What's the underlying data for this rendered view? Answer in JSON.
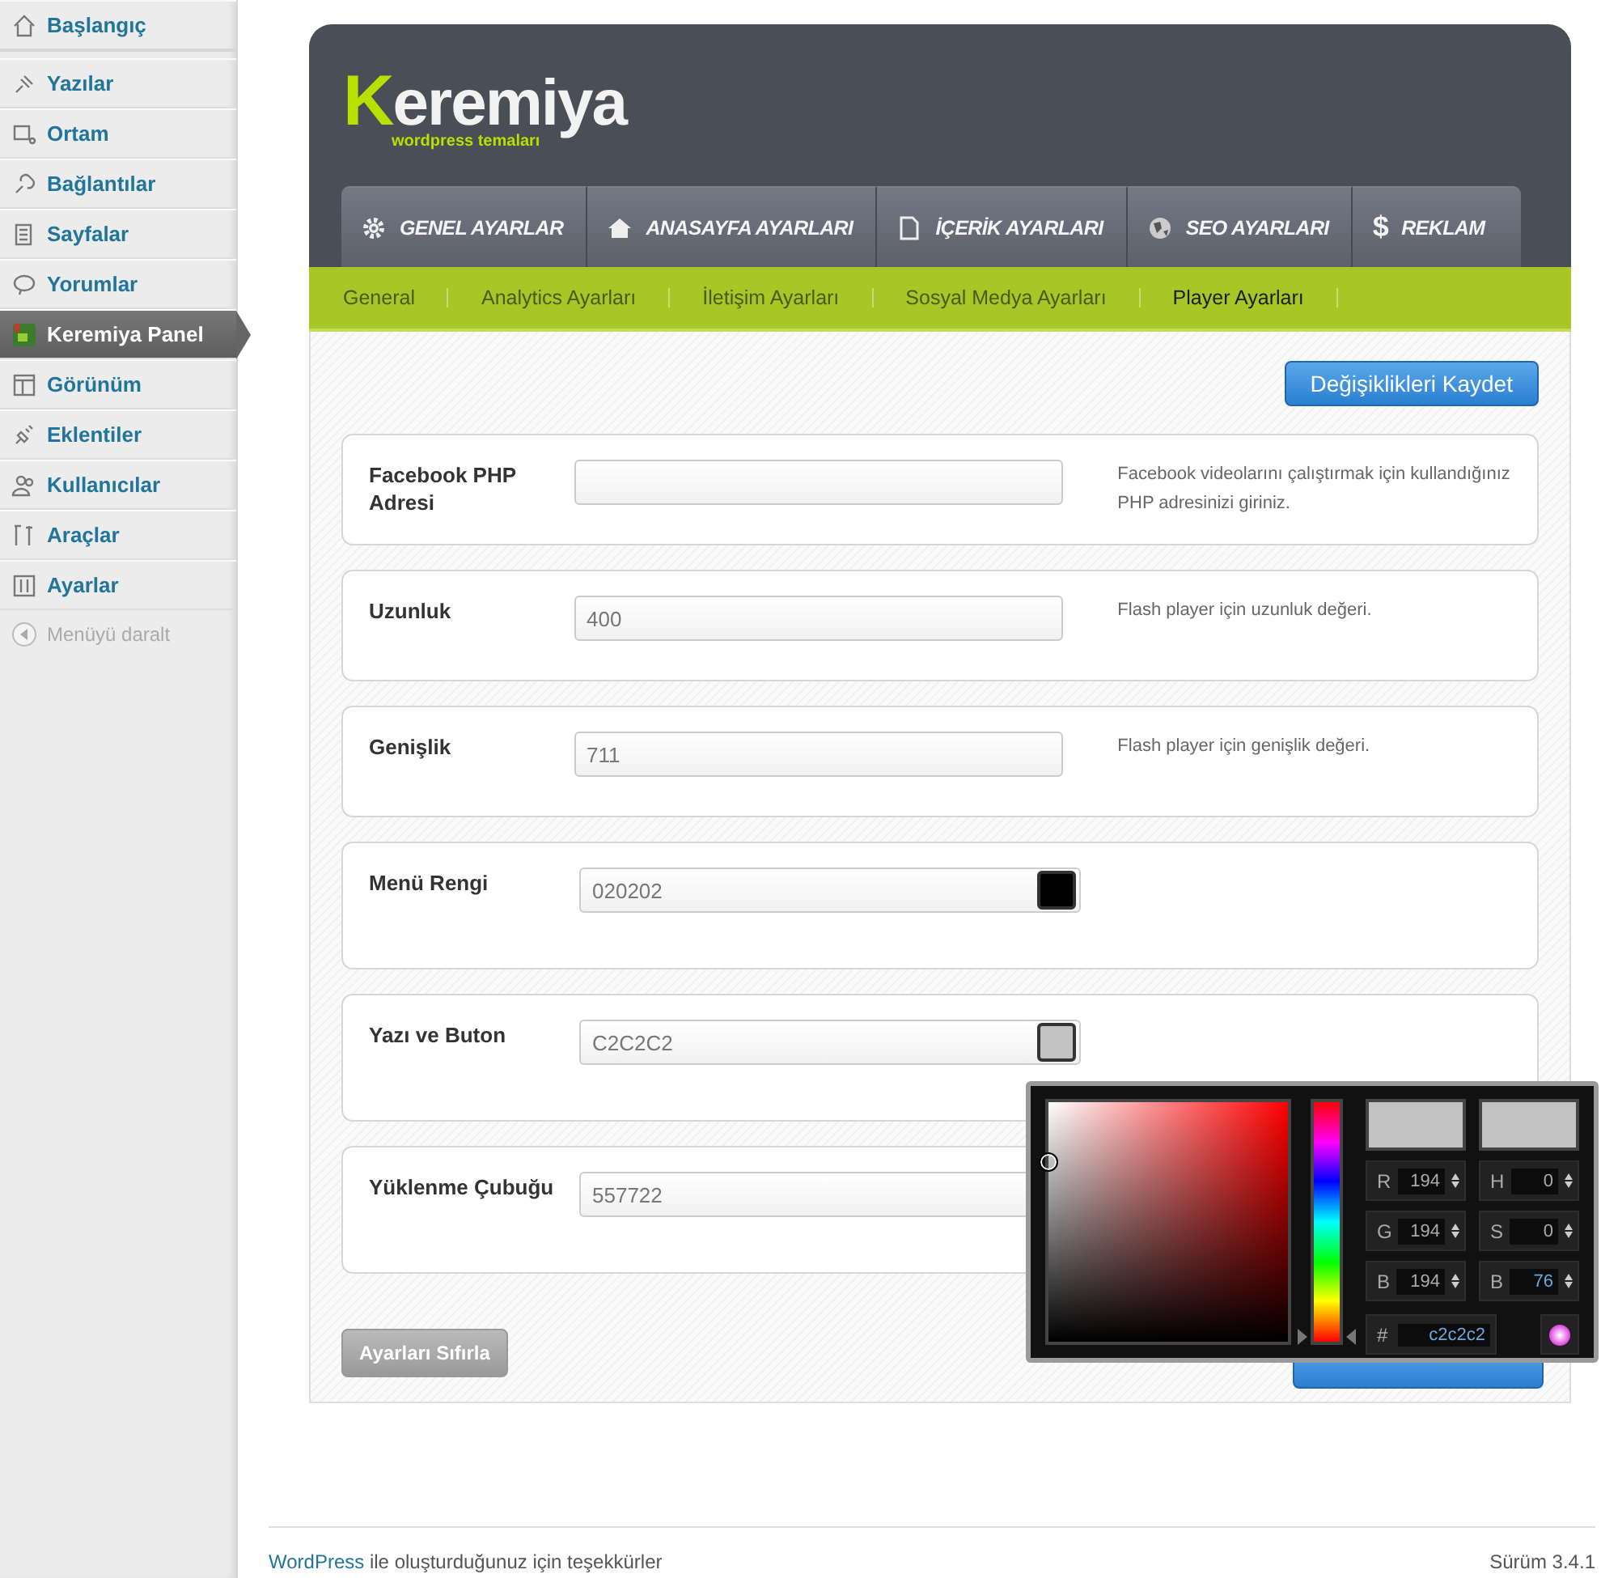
{
  "sidebar": {
    "items": [
      {
        "label": "Başlangıç",
        "selected": false,
        "kind": "item"
      },
      {
        "label": "Yazılar",
        "selected": false,
        "kind": "item"
      },
      {
        "label": "Ortam",
        "selected": false,
        "kind": "item"
      },
      {
        "label": "Bağlantılar",
        "selected": false,
        "kind": "item"
      },
      {
        "label": "Sayfalar",
        "selected": false,
        "kind": "item"
      },
      {
        "label": "Yorumlar",
        "selected": false,
        "kind": "item"
      },
      {
        "label": "Keremiya Panel",
        "selected": true,
        "kind": "item"
      },
      {
        "label": "Görünüm",
        "selected": false,
        "kind": "item"
      },
      {
        "label": "Eklentiler",
        "selected": false,
        "kind": "item"
      },
      {
        "label": "Kullanıcılar",
        "selected": false,
        "kind": "item"
      },
      {
        "label": "Araçlar",
        "selected": false,
        "kind": "item"
      },
      {
        "label": "Ayarlar",
        "selected": false,
        "kind": "item"
      },
      {
        "label": "Menüyü daralt",
        "selected": false,
        "kind": "collapse"
      }
    ]
  },
  "logo": {
    "initial": "K",
    "rest": "eremiya",
    "tagline": "wordpress temaları"
  },
  "tabs": [
    {
      "label": "GENEL AYARLAR",
      "selected": false
    },
    {
      "label": "ANASAYFA AYARLARI",
      "selected": false
    },
    {
      "label": "İÇERİK AYARLARI",
      "selected": false
    },
    {
      "label": "SEO AYARLARI",
      "selected": false
    },
    {
      "label": "REKLAM",
      "selected": false,
      "symbol": "$"
    }
  ],
  "subnav": [
    {
      "label": "General",
      "selected": false
    },
    {
      "label": "Analytics Ayarları",
      "selected": false
    },
    {
      "label": "İletişim Ayarları",
      "selected": false
    },
    {
      "label": "Sosyal Medya Ayarları",
      "selected": false
    },
    {
      "label": "Player Ayarları",
      "selected": true
    }
  ],
  "save_button": "Değişiklikleri Kaydet",
  "fields": [
    {
      "kind": "text",
      "label": "Facebook PHP Adresi",
      "description": "Facebook videolarını çalıştırmak için kullandığınız PHP adresinizi giriniz."
    },
    {
      "kind": "text",
      "label": "Uzunluk",
      "value": "400",
      "description": "Flash player için uzunluk değeri."
    },
    {
      "kind": "text",
      "label": "Genişlik",
      "value": "711",
      "description": "Flash player için genişlik değeri."
    },
    {
      "kind": "color",
      "label": "Menü Rengi",
      "value": "020202",
      "color": "#020202"
    },
    {
      "kind": "color",
      "label": "Yazı ve Buton",
      "value": "C2C2C2",
      "color": "#c2c2c2"
    },
    {
      "kind": "color",
      "label": "Yüklenme Çubuğu",
      "value": "557722"
    }
  ],
  "reset_button": "Ayarları Sıfırla",
  "color_picker": {
    "hue": {
      "level": 0
    },
    "channels": [
      {
        "label": "R",
        "value": "194"
      },
      {
        "label": "H",
        "value": "0"
      },
      {
        "label": "G",
        "value": "194"
      },
      {
        "label": "S",
        "value": "0"
      },
      {
        "label": "B",
        "value": "194"
      },
      {
        "label": "B",
        "value": "76"
      }
    ],
    "hex_label": "#",
    "hex": "c2c2c2"
  },
  "footer": {
    "link": "WordPress",
    "text": " ile oluşturduğunuz için teşekkürler",
    "version": "Sürüm 3.4.1"
  }
}
